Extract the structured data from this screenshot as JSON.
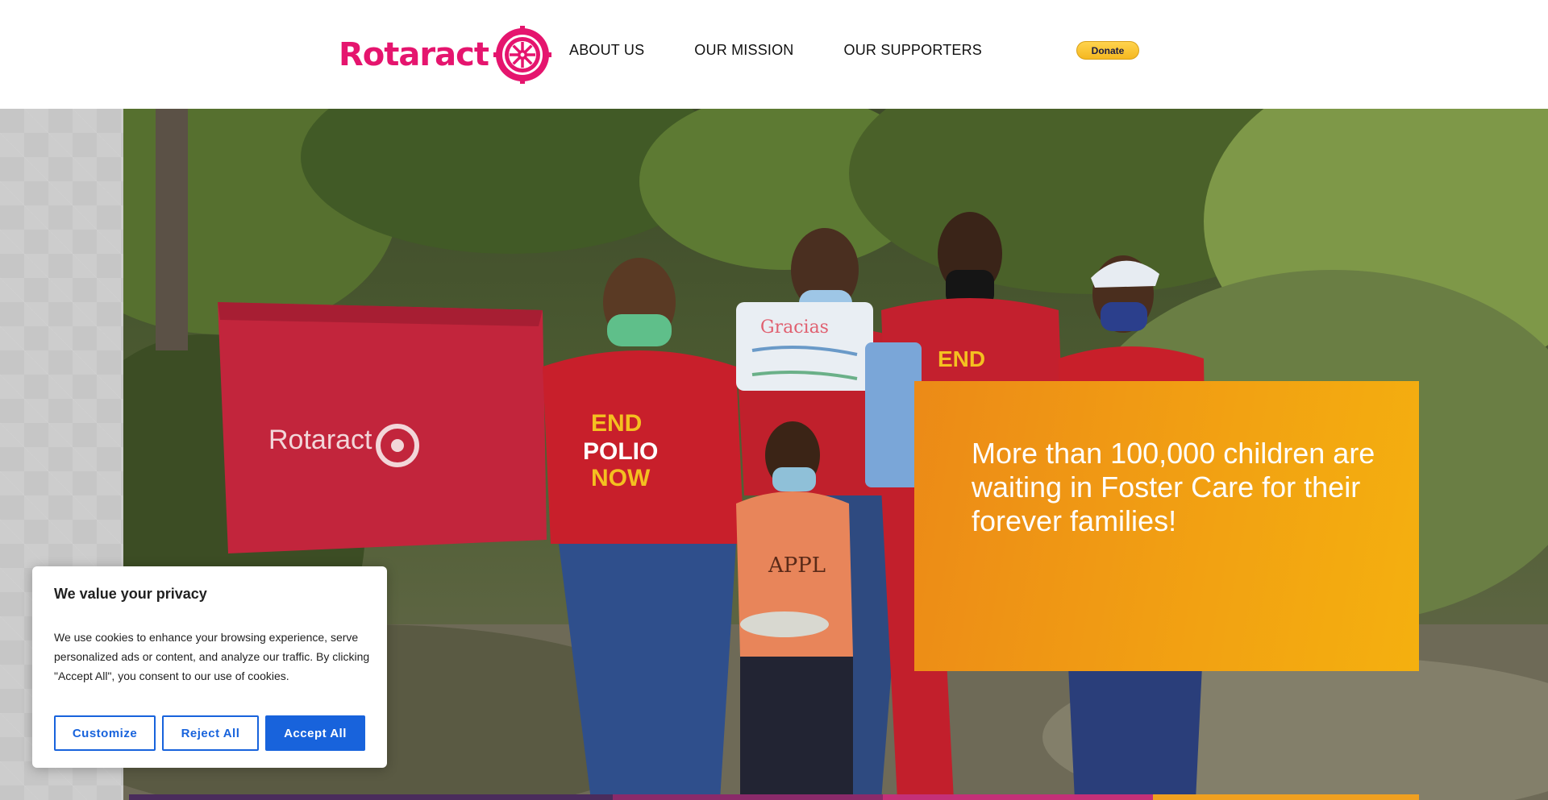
{
  "header": {
    "logo_text": "Rotaract",
    "nav": [
      {
        "label": "ABOUT US"
      },
      {
        "label": "OUR MISSION"
      },
      {
        "label": "OUR SUPPORTERS"
      }
    ],
    "donate_label": "Donate"
  },
  "hero": {
    "headline": "More than 100,000 children are waiting in Foster Care for their forever families!",
    "flag_text": "Rotaract",
    "shirt_text": "END POLIO NOW",
    "sign_text": "Gracias"
  },
  "cookie_banner": {
    "title": "We value your privacy",
    "body": "We use cookies to enhance your browsing experience, serve personalized ads or content, and analyze our traffic. By clicking \"Accept All\", you consent to our use of cookies.",
    "buttons": {
      "customize": "Customize",
      "reject": "Reject All",
      "accept": "Accept All"
    }
  },
  "colors": {
    "brand": "#e5156e",
    "promo_orange": "#f09a14",
    "cookie_button": "#1863dc",
    "donate_yellow": "#ffc439"
  }
}
